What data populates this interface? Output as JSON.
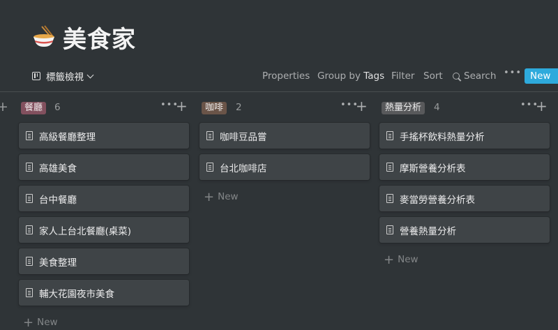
{
  "page": {
    "emoji": "ramen-bowl-icon",
    "title": "美食家"
  },
  "toolbar": {
    "view_label": "標籤檢視",
    "properties": "Properties",
    "group_by_prefix": "Group by",
    "group_by_value": "Tags",
    "filter": "Filter",
    "sort": "Sort",
    "search": "Search",
    "more": "•••",
    "new": "New"
  },
  "board": {
    "add_new_label": "New",
    "more": "•••",
    "add": "+",
    "columns": [
      {
        "tag": "餐廳",
        "tag_color": "#82505e",
        "count": "6",
        "cards": [
          "高級餐廳整理",
          "高雄美食",
          "台中餐廳",
          "家人上台北餐廳(桌菜)",
          "美食整理",
          "輔大花園夜市美食"
        ]
      },
      {
        "tag": "咖啡",
        "tag_color": "#6a5448",
        "count": "2",
        "cards": [
          "咖啡豆品嘗",
          "台北咖啡店"
        ]
      },
      {
        "tag": "熱量分析",
        "tag_color": "#58595b",
        "count": "4",
        "cards": [
          "手搖杯飲料熱量分析",
          "摩斯營養分析表",
          "麥當勞營養分析表",
          "營養熱量分析"
        ]
      }
    ]
  },
  "colors": {
    "background": "#2f3437",
    "card": "#3f4447",
    "accent": "#2eaadc"
  }
}
